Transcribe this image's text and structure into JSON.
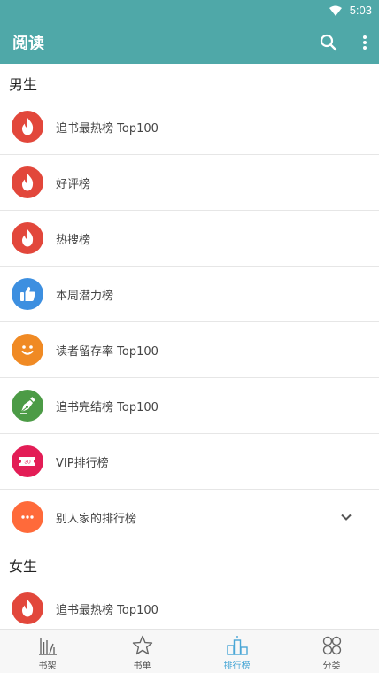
{
  "status_bar": {
    "time": "5:03"
  },
  "app_bar": {
    "title": "阅读"
  },
  "sections": [
    {
      "title": "男生",
      "items": [
        {
          "label": "追书最热榜 Top100",
          "icon": "flame-icon",
          "color": "#e2473b"
        },
        {
          "label": "好评榜",
          "icon": "flame-icon",
          "color": "#e2473b"
        },
        {
          "label": "热搜榜",
          "icon": "flame-icon",
          "color": "#e2473b"
        },
        {
          "label": "本周潜力榜",
          "icon": "thumbs-up-icon",
          "color": "#3d8fe0"
        },
        {
          "label": "读者留存率 Top100",
          "icon": "smiley-icon",
          "color": "#f08a24"
        },
        {
          "label": "追书完结榜 Top100",
          "icon": "pen-nib-icon",
          "color": "#4c9b46"
        },
        {
          "label": "VIP排行榜",
          "icon": "ticket-icon",
          "color": "#e31d56",
          "ticket_text": "30"
        },
        {
          "label": "别人家的排行榜",
          "icon": "more-dots-icon",
          "color": "#ff6a3a"
        }
      ]
    },
    {
      "title": "女生",
      "items": [
        {
          "label": "追书最热榜 Top100",
          "icon": "flame-icon",
          "color": "#e2473b"
        }
      ]
    }
  ],
  "bottom_nav": [
    {
      "label": "书架",
      "icon": "bookshelf-icon",
      "active": false
    },
    {
      "label": "书单",
      "icon": "star-icon",
      "active": false
    },
    {
      "label": "排行榜",
      "icon": "ranking-icon",
      "active": true
    },
    {
      "label": "分类",
      "icon": "category-icon",
      "active": false
    }
  ],
  "colors": {
    "primary": "#4fa8a8",
    "active_nav": "#4aa7d6"
  }
}
